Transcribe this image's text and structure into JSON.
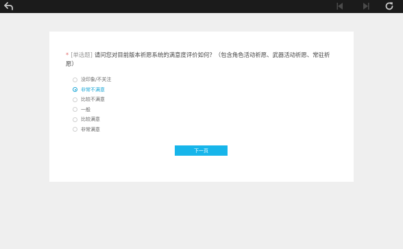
{
  "toolbar": {
    "back_icon": "undo-arrow-icon",
    "prev_icon": "prev-arrow-icon",
    "next_icon": "next-arrow-icon",
    "refresh_icon": "refresh-icon"
  },
  "question": {
    "required_mark": "*",
    "type_label": "[单选题]",
    "text": "请问您对目前版本祈愿系统的满意度评价如何？（包含角色活动祈愿、武器活动祈愿、常驻祈愿）"
  },
  "options": [
    {
      "label": "没印象/不关注",
      "selected": false
    },
    {
      "label": "非常不满意",
      "selected": true
    },
    {
      "label": "比较不满意",
      "selected": false
    },
    {
      "label": "一般",
      "selected": false
    },
    {
      "label": "比较满意",
      "selected": false
    },
    {
      "label": "非常满意",
      "selected": false
    }
  ],
  "next_button": "下一页",
  "colors": {
    "accent": "#17b5ea",
    "topbar": "#1b1b1b",
    "background": "#efefef"
  }
}
